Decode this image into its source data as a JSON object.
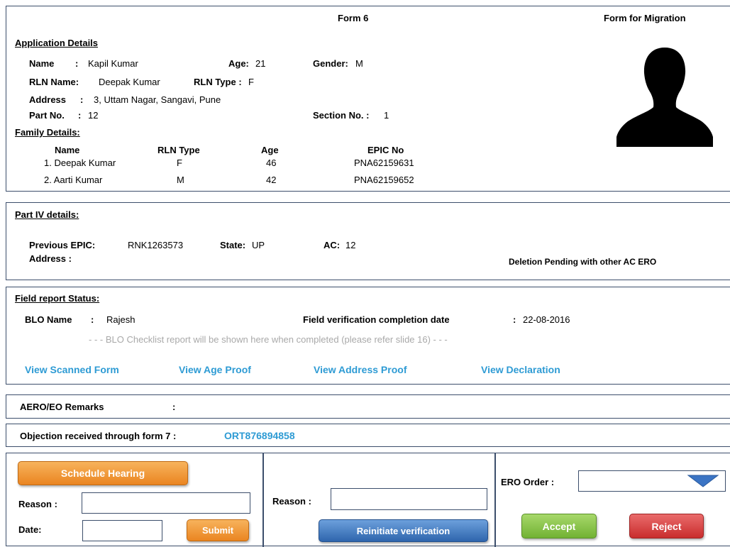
{
  "header": {
    "form_no": "Form 6",
    "form_title": "Form for Migration"
  },
  "application": {
    "heading": "Application Details",
    "name_label": "Name",
    "name_sep": ":",
    "name_value": "Kapil Kumar",
    "age_label": "Age:",
    "age_value": "21",
    "gender_label": "Gender:",
    "gender_value": "M",
    "rln_name_label": "RLN Name:",
    "rln_name_value": "Deepak Kumar",
    "rln_type_label": "RLN Type :",
    "rln_type_value": "F",
    "address_label": "Address",
    "address_sep": ":",
    "address_value": "3, Uttam Nagar, Sangavi, Pune",
    "part_label": "Part No.",
    "part_sep": ":",
    "part_value": "12",
    "section_label": "Section No. :",
    "section_value": "1"
  },
  "family": {
    "heading": "Family Details:",
    "columns": [
      "Name",
      "RLN Type",
      "Age",
      "EPIC No"
    ],
    "rows": [
      {
        "name": "1. Deepak Kumar",
        "rln_type": "F",
        "age": "46",
        "epic": "PNA62159631"
      },
      {
        "name": "2. Aarti Kumar",
        "rln_type": "M",
        "age": "42",
        "epic": "PNA62159652"
      }
    ]
  },
  "part4": {
    "heading": "Part IV details:",
    "prev_epic_label": "Previous EPIC:",
    "prev_epic_value": "RNK1263573",
    "state_label": "State:",
    "state_value": "UP",
    "ac_label": "AC:",
    "ac_value": "12",
    "address_label": "Address :",
    "status_note": "Deletion Pending with other AC ERO"
  },
  "field_report": {
    "heading": "Field report Status:",
    "blo_label": "BLO Name",
    "blo_sep": ":",
    "blo_value": "Rajesh",
    "completion_label": "Field verification completion date",
    "completion_sep": ":",
    "completion_value": "22-08-2016",
    "checklist_note": "- - - BLO Checklist report will be shown here when completed (please refer slide 16) - - -",
    "links": [
      "View Scanned Form",
      "View Age Proof",
      "View Address Proof",
      "View Declaration"
    ]
  },
  "remarks": {
    "label": "AERO/EO Remarks",
    "sep": ":"
  },
  "objection": {
    "label": "Objection received through form 7 :",
    "value": "ORT876894858"
  },
  "actions": {
    "schedule_button": "Schedule Hearing",
    "reason_label": "Reason :",
    "date_label": "Date:",
    "submit_button": "Submit",
    "reason2_label": "Reason :",
    "reinitiate_button": "Reinitiate verification",
    "ero_order_label": "ERO Order :",
    "accept_button": "Accept",
    "reject_button": "Reject"
  },
  "icons": {
    "photo": "person-silhouette-icon",
    "dropdown": "chevron-down-icon"
  },
  "colors": {
    "border": "#3c4e6b",
    "link": "#2e9bd4",
    "orange": "#ea8521",
    "blue": "#2f65ad",
    "green": "#72b234",
    "red": "#c92d2d"
  }
}
